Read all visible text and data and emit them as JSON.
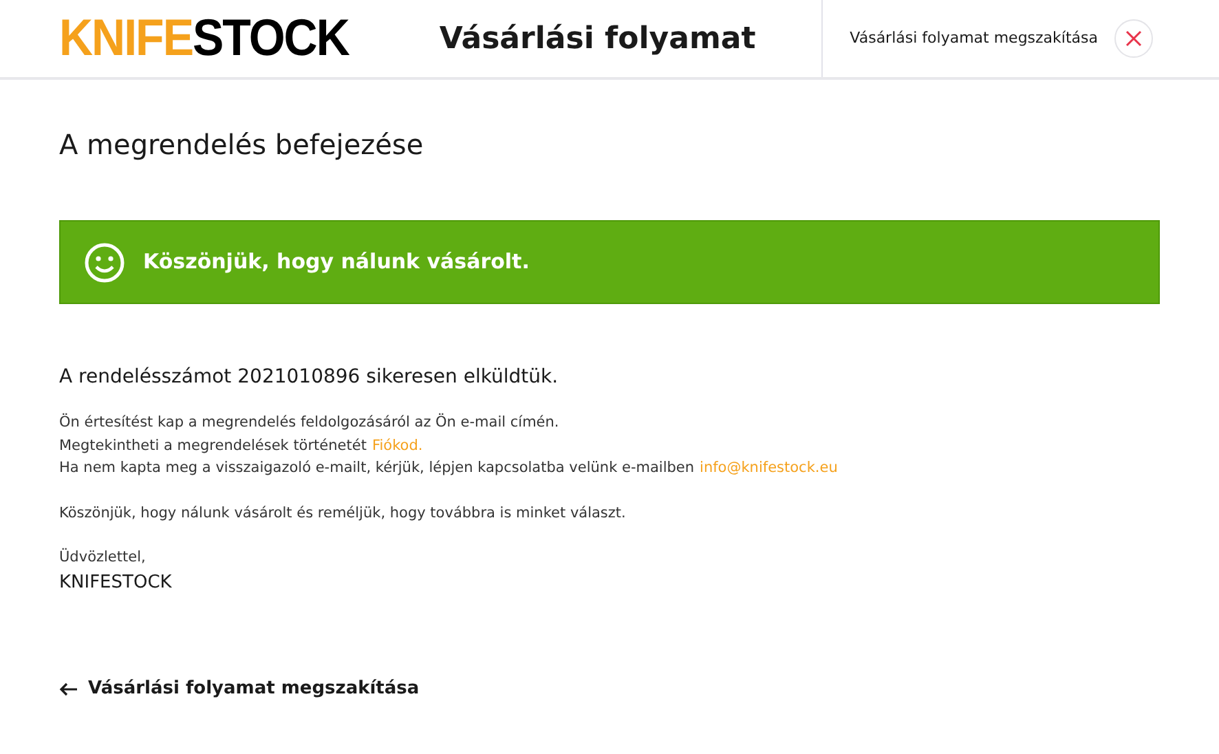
{
  "header": {
    "logo": {
      "accent": "KNIFE",
      "rest": "STOCK"
    },
    "title": "Vásárlási folyamat",
    "cancel_label": "Vásárlási folyamat megszakítása"
  },
  "heading": "A megrendelés befejezése",
  "alert": {
    "text": "Köszönjük, hogy nálunk vásárolt."
  },
  "confirmation": "A rendelésszámot 2021010896 sikeresen elküldtük.",
  "lines": [
    {
      "text": "Ön értesítést kap a megrendelés feldolgozásáról az Ön e-mail címén."
    },
    {
      "text": "Megtekintheti a megrendelések történetét",
      "link": "Fiókod."
    },
    {
      "text": "Ha nem kapta meg a visszaigazoló e-mailt, kérjük, lépjen kapcsolatba velünk e-mailben",
      "link": "info@knifestock.eu"
    }
  ],
  "thanks": "Köszönjük, hogy nálunk vásárolt és reméljük, hogy továbbra is minket választ.",
  "greeting": "Üdvözlettel,",
  "signature": "KNIFESTOCK",
  "back_link": "Vásárlási folyamat megszakítása"
}
